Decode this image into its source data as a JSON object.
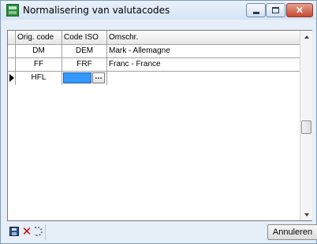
{
  "window": {
    "title": "Normalisering van valutacodes",
    "controls": {
      "minimize_icon": "minimize-icon",
      "maximize_icon": "maximize-icon",
      "close_icon": "close-icon"
    }
  },
  "grid": {
    "columns": [
      "Orig. code",
      "Code ISO",
      "Omschr."
    ],
    "rows": [
      {
        "orig": "DM",
        "iso": "DEM",
        "omschr": "Mark - Allemagne"
      },
      {
        "orig": "FF",
        "iso": "FRF",
        "omschr": "Franc - France"
      },
      {
        "orig": "HFL",
        "iso": "",
        "omschr": ""
      }
    ],
    "current_row_indicator": "current-row-arrow-icon",
    "edit_button_label": "…",
    "selection_color": "#3399ff"
  },
  "footer": {
    "tools": [
      "save-icon",
      "delete-icon",
      "refresh-icon"
    ],
    "cancel_label": "Annuleren"
  }
}
